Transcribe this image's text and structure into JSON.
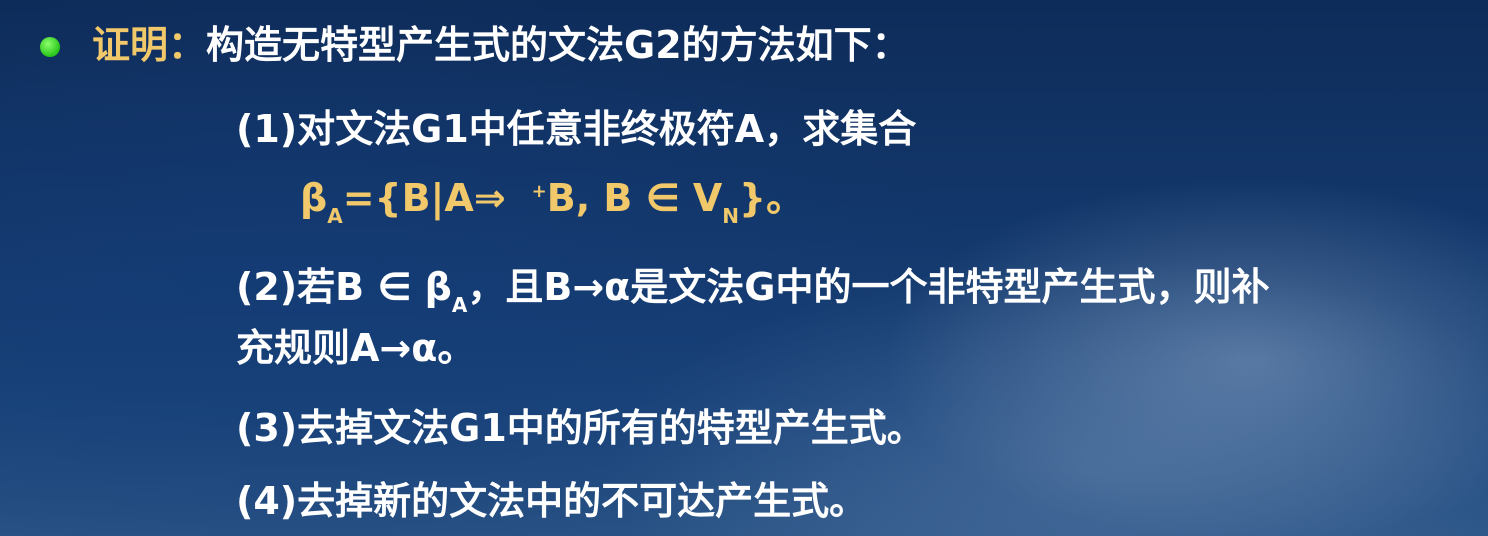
{
  "proof": {
    "label": "证明",
    "colon": "：",
    "heading": "构造无特型产生式的文法G2的方法如下："
  },
  "steps": {
    "s1": "(1)对文法G1中任意非终极符A，求集合",
    "formula": {
      "beta": "β",
      "beta_sub": "A",
      "part1": "={B|A⇒",
      "plus": "+",
      "part2": "B, B ∈ V",
      "v_sub": "N",
      "part3": "}。"
    },
    "s2": {
      "start": "(2)若B ∈ β",
      "sub": "A",
      "rest": "，且B→α是文法G中的一个非特型产生式，则补",
      "line2": "充规则A→α。"
    },
    "s3": "(3)去掉文法G1中的所有的特型产生式。",
    "s4": "(4)去掉新的文法中的不可达产生式。"
  },
  "colors": {
    "highlight": "#f1c86a",
    "text": "#ffffff",
    "bullet": "#27c41a"
  }
}
